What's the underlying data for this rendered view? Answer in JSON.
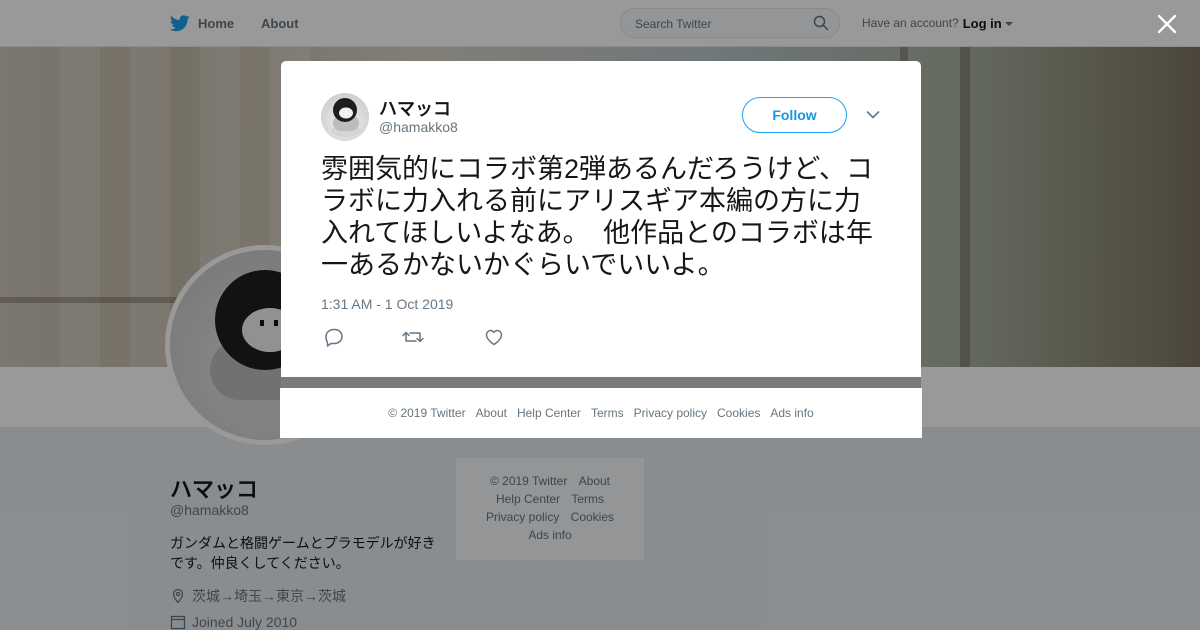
{
  "header": {
    "home_label": "Home",
    "about_label": "About",
    "search_placeholder": "Search Twitter",
    "account_prompt": "Have an account?",
    "login_label": "Log in"
  },
  "profile": {
    "name": "ハマッコ",
    "handle": "@hamakko8",
    "bio": "ガンダムと格闘ゲームとプラモデルが好きです。仲良くしてください。",
    "location": "茨城→埼玉→東京→茨城",
    "joined": "Joined July 2010"
  },
  "side_footer": {
    "links": [
      "© 2019 Twitter",
      "About",
      "Help Center",
      "Terms",
      "Privacy policy",
      "Cookies",
      "Ads info"
    ]
  },
  "tweet": {
    "author_name": "ハマッコ",
    "author_handle": "@hamakko8",
    "follow_label": "Follow",
    "text": "雰囲気的にコラボ第2弾あるんだろうけど、コラボに力入れる前にアリスギア本編の方に力入れてほしいよなあ。　他作品とのコラボは年一あるかないかぐらいでいいよ。",
    "timestamp": "1:31 AM - 1 Oct 2019"
  },
  "modal_footer": {
    "links": [
      "© 2019 Twitter",
      "About",
      "Help Center",
      "Terms",
      "Privacy policy",
      "Cookies",
      "Ads info"
    ]
  },
  "colors": {
    "accent": "#1da1f2",
    "muted": "#66757f",
    "overlay": "rgba(0,0,0,0.4)"
  }
}
